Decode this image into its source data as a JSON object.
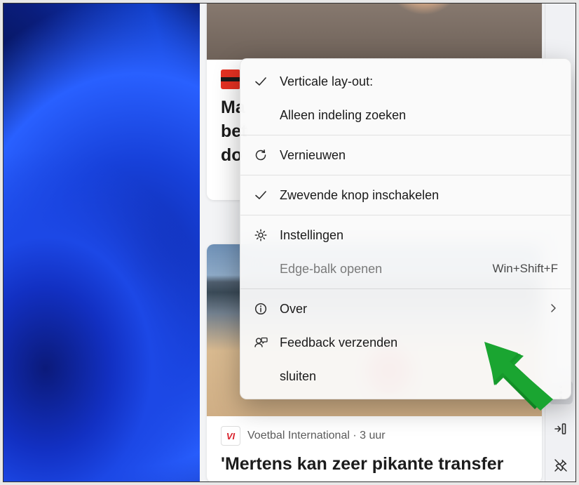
{
  "feed": {
    "card1": {
      "title_partial": "Ma\nbet\ndo"
    },
    "card2": {
      "source_icon_text": "VI",
      "source": "Voetbal International",
      "time": "3 uur",
      "title": "'Mertens kan zeer pikante transfer"
    }
  },
  "menu": {
    "items": [
      {
        "icon": "check",
        "label": "Verticale lay-out:"
      },
      {
        "icon": "",
        "label": "Alleen indeling zoeken"
      },
      {
        "sep": true
      },
      {
        "icon": "refresh",
        "label": "Vernieuwen"
      },
      {
        "sep": true
      },
      {
        "icon": "check",
        "label": "Zwevende knop inschakelen"
      },
      {
        "sep": true
      },
      {
        "icon": "gear",
        "label": "Instellingen"
      },
      {
        "icon": "",
        "label": "Edge-balk openen",
        "shortcut": "Win+Shift+F",
        "disabled": true
      },
      {
        "sep": true
      },
      {
        "icon": "info",
        "label": "Over",
        "chevron": true
      },
      {
        "icon": "feedback",
        "label": "Feedback verzenden"
      },
      {
        "icon": "",
        "label": "sluiten"
      }
    ]
  },
  "sidebar": {
    "more": "more-options",
    "collapse": "collapse-sidebar",
    "unpin": "unpin-sidebar"
  }
}
